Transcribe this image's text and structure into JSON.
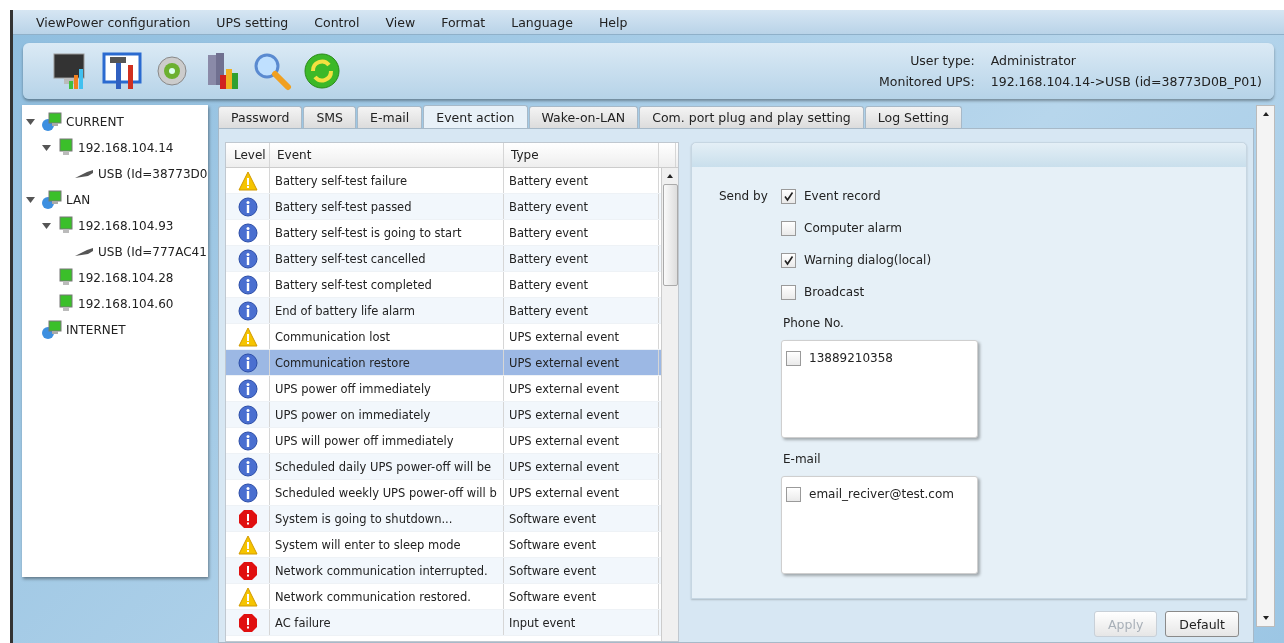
{
  "menu": [
    "ViewPower configuration",
    "UPS setting",
    "Control",
    "View",
    "Format",
    "Language",
    "Help"
  ],
  "info": [
    {
      "label": "User type:",
      "value": "Administrator"
    },
    {
      "label": "Monitored UPS:",
      "value": "192.168.104.14->USB (id=38773D0B_P01)"
    }
  ],
  "tree": [
    {
      "label": "CURRENT",
      "kind": "network",
      "expanded": true,
      "children": [
        {
          "label": "192.168.104.14",
          "kind": "computer",
          "expanded": true,
          "children": [
            {
              "label": "USB (Id=38773D0",
              "kind": "usb"
            }
          ]
        }
      ]
    },
    {
      "label": "LAN",
      "kind": "network",
      "expanded": true,
      "children": [
        {
          "label": "192.168.104.93",
          "kind": "computer",
          "expanded": true,
          "children": [
            {
              "label": "USB (Id=777AC41",
              "kind": "usb"
            }
          ]
        },
        {
          "label": "192.168.104.28",
          "kind": "computer"
        },
        {
          "label": "192.168.104.60",
          "kind": "computer"
        }
      ]
    },
    {
      "label": "INTERNET",
      "kind": "network"
    }
  ],
  "tabs": [
    {
      "label": "Password",
      "selected": false
    },
    {
      "label": "SMS",
      "selected": false
    },
    {
      "label": "E-mail",
      "selected": false
    },
    {
      "label": "Event action",
      "selected": true
    },
    {
      "label": "Wake-on-LAN",
      "selected": false
    },
    {
      "label": "Com. port plug and play setting",
      "selected": false
    },
    {
      "label": "Log Setting",
      "selected": false
    }
  ],
  "table": {
    "columns": [
      "Level",
      "Event",
      "Type"
    ],
    "rows": [
      {
        "kind": "warning",
        "event": "Battery self-test failure",
        "type": "Battery event",
        "selected": false
      },
      {
        "kind": "info",
        "event": "Battery self-test passed",
        "type": "Battery event",
        "selected": false
      },
      {
        "kind": "info",
        "event": "Battery self-test is going to start",
        "type": "Battery event",
        "selected": false
      },
      {
        "kind": "info",
        "event": "Battery self-test cancelled",
        "type": "Battery event",
        "selected": false
      },
      {
        "kind": "info",
        "event": "Battery self-test completed",
        "type": "Battery event",
        "selected": false
      },
      {
        "kind": "info",
        "event": "End of battery life alarm",
        "type": "Battery event",
        "selected": false
      },
      {
        "kind": "warning",
        "event": "Communication lost",
        "type": "UPS external event",
        "selected": false
      },
      {
        "kind": "info",
        "event": "Communication restore",
        "type": "UPS external event",
        "selected": true
      },
      {
        "kind": "info",
        "event": "UPS power off immediately",
        "type": "UPS external event",
        "selected": false
      },
      {
        "kind": "info",
        "event": "UPS power on immediately",
        "type": "UPS external event",
        "selected": false
      },
      {
        "kind": "info",
        "event": "UPS will power off immediately",
        "type": "UPS external event",
        "selected": false
      },
      {
        "kind": "info",
        "event": "Scheduled daily UPS power-off will be",
        "type": "UPS external event",
        "selected": false
      },
      {
        "kind": "info",
        "event": "Scheduled weekly UPS power-off will b",
        "type": "UPS external event",
        "selected": false
      },
      {
        "kind": "error",
        "event": "System is going to shutdown...",
        "type": "Software event",
        "selected": false
      },
      {
        "kind": "warning",
        "event": "System will enter to sleep mode",
        "type": "Software event",
        "selected": false
      },
      {
        "kind": "error",
        "event": "Network communication interrupted.",
        "type": "Software event",
        "selected": false
      },
      {
        "kind": "warning",
        "event": "Network communication restored.",
        "type": "Software event",
        "selected": false
      },
      {
        "kind": "error",
        "event": "AC failure",
        "type": "Input event",
        "selected": false
      }
    ]
  },
  "send_by": {
    "label": "Send by",
    "options": [
      {
        "label": "Event record",
        "checked": true
      },
      {
        "label": "Computer alarm",
        "checked": false
      },
      {
        "label": "Warning dialog(local)",
        "checked": true
      },
      {
        "label": "Broadcast",
        "checked": false
      }
    ]
  },
  "phone": {
    "label": "Phone No.",
    "items": [
      {
        "label": "13889210358",
        "checked": false
      }
    ]
  },
  "email": {
    "label": "E-mail",
    "items": [
      {
        "label": "email_reciver@test.com",
        "checked": false
      }
    ]
  },
  "buttons": [
    {
      "label": "Apply",
      "disabled": true
    },
    {
      "label": "Default",
      "disabled": false
    }
  ]
}
